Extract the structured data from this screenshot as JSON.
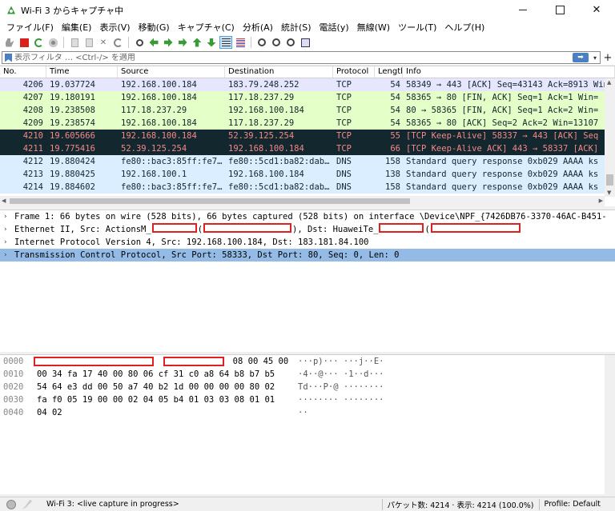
{
  "window": {
    "title": "Wi-Fi 3 からキャプチャ中",
    "minimize": "",
    "maximize": "",
    "close": "✕"
  },
  "menu": [
    "ファイル(F)",
    "編集(E)",
    "表示(V)",
    "移動(G)",
    "キャプチャ(C)",
    "分析(A)",
    "統計(S)",
    "電話(y)",
    "無線(W)",
    "ツール(T)",
    "ヘルプ(H)"
  ],
  "filter": {
    "placeholder": "表示フィルタ … <Ctrl-/> を適用",
    "apply": "➡",
    "dropdown": "▾",
    "add": "+"
  },
  "packet_list": {
    "columns": [
      "No.",
      "Time",
      "Source",
      "Destination",
      "Protocol",
      "Length",
      "Info"
    ],
    "rows": [
      {
        "no": "4206",
        "time": "19.037724",
        "src": "192.168.100.184",
        "dst": "183.79.248.252",
        "proto": "TCP",
        "len": "54",
        "info": "58349 → 443 [ACK] Seq=43143 Ack=8913 Win",
        "bg": "#e7e6ff",
        "fg": "#12272e"
      },
      {
        "no": "4207",
        "time": "19.180191",
        "src": "192.168.100.184",
        "dst": "117.18.237.29",
        "proto": "TCP",
        "len": "54",
        "info": "58365 → 80 [FIN, ACK] Seq=1 Ack=1 Win=",
        "bg": "#e4ffc7",
        "fg": "#12272e"
      },
      {
        "no": "4208",
        "time": "19.238508",
        "src": "117.18.237.29",
        "dst": "192.168.100.184",
        "proto": "TCP",
        "len": "54",
        "info": "80 → 58365 [FIN, ACK] Seq=1 Ack=2 Win=",
        "bg": "#e4ffc7",
        "fg": "#12272e"
      },
      {
        "no": "4209",
        "time": "19.238574",
        "src": "192.168.100.184",
        "dst": "117.18.237.29",
        "proto": "TCP",
        "len": "54",
        "info": "58365 → 80 [ACK] Seq=2 Ack=2 Win=13107",
        "bg": "#e4ffc7",
        "fg": "#12272e"
      },
      {
        "no": "4210",
        "time": "19.605666",
        "src": "192.168.100.184",
        "dst": "52.39.125.254",
        "proto": "TCP",
        "len": "55",
        "info": "[TCP Keep-Alive] 58337 → 443 [ACK] Seq",
        "bg": "#12272e",
        "fg": "#f78787"
      },
      {
        "no": "4211",
        "time": "19.775416",
        "src": "52.39.125.254",
        "dst": "192.168.100.184",
        "proto": "TCP",
        "len": "66",
        "info": "[TCP Keep-Alive ACK] 443 → 58337 [ACK]",
        "bg": "#12272e",
        "fg": "#f78787"
      },
      {
        "no": "4212",
        "time": "19.880424",
        "src": "fe80::bac3:85ff:fe7…",
        "dst": "fe80::5cd1:ba82:dab…",
        "proto": "DNS",
        "len": "158",
        "info": "Standard query response 0xb029 AAAA ks",
        "bg": "#daeeff",
        "fg": "#12272e"
      },
      {
        "no": "4213",
        "time": "19.880425",
        "src": "192.168.100.1",
        "dst": "192.168.100.184",
        "proto": "DNS",
        "len": "138",
        "info": "Standard query response 0xb029 AAAA ks",
        "bg": "#daeeff",
        "fg": "#12272e"
      },
      {
        "no": "4214",
        "time": "19.884602",
        "src": "fe80::bac3:85ff:fe7…",
        "dst": "fe80::5cd1:ba82:dab…",
        "proto": "DNS",
        "len": "158",
        "info": "Standard query response 0xb029 AAAA ks",
        "bg": "#daeeff",
        "fg": "#12272e"
      }
    ]
  },
  "details": {
    "frame": "Frame 1: 66 bytes on wire (528 bits), 66 bytes captured (528 bits) on interface \\Device\\NPF_{7426DB76-3370-46AC-B451-",
    "eth_a": "Ethernet II, Src: ActionsM_",
    "eth_b": "(",
    "eth_c": "), Dst: HuaweiTe_",
    "eth_d": "(",
    "ip": "Internet Protocol Version 4, Src: 192.168.100.184, Dst: 183.181.84.100",
    "tcp": "Transmission Control Protocol, Src Port: 58333, Dst Port: 80, Seq: 0, Len: 0",
    "caret": "›"
  },
  "hex": [
    {
      "off": "0000",
      "bytes": "08 00 45 00",
      "ascii": "···p)··· ···j··E·"
    },
    {
      "off": "0010",
      "bytes": "00 34 fa 17 40 00 80 06  cf 31 c0 a8 64 b8 b7 b5",
      "ascii": "·4··@··· ·1··d···"
    },
    {
      "off": "0020",
      "bytes": "54 64 e3 dd 00 50 a7 40  b2 1d 00 00 00 00 80 02",
      "ascii": "Td···P·@ ········"
    },
    {
      "off": "0030",
      "bytes": "fa f0 05 19 00 00 02 04  05 b4 01 03 03 08 01 01",
      "ascii": "········ ········"
    },
    {
      "off": "0040",
      "bytes": "04 02",
      "ascii": "··"
    }
  ],
  "status": {
    "text": "Wi-Fi 3: <live capture in progress>",
    "count": "パケット数: 4214 · 表示: 4214 (100.0%)",
    "profile": "Profile: Default"
  },
  "colors": {
    "selected": "#93bbe6",
    "redaction": "#e02020"
  }
}
